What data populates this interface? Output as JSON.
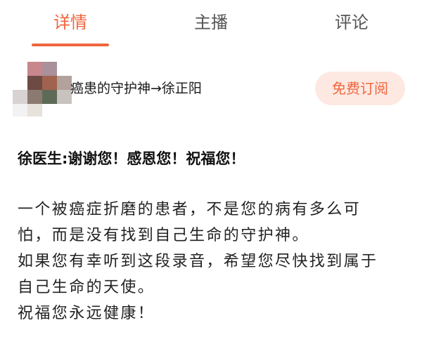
{
  "tabs": [
    {
      "label": "详情",
      "active": true
    },
    {
      "label": "主播",
      "active": false
    },
    {
      "label": "评论",
      "active": false
    }
  ],
  "accent_color": "#f0663f",
  "channel": {
    "title": "癌患的守护神→徐正阳",
    "subscribe_label": "免费订阅"
  },
  "content": {
    "heading": "徐医生:谢谢您！感恩您！祝福您！",
    "lines": [
      "一个被癌症折磨的患者，不是您的病有多么可",
      "怕，而是没有找到自己生命的守护神。",
      "如果您有幸听到这段录音，希望您尽快找到属于",
      "自己生命的天使。",
      "祝福您永远健康！"
    ]
  }
}
